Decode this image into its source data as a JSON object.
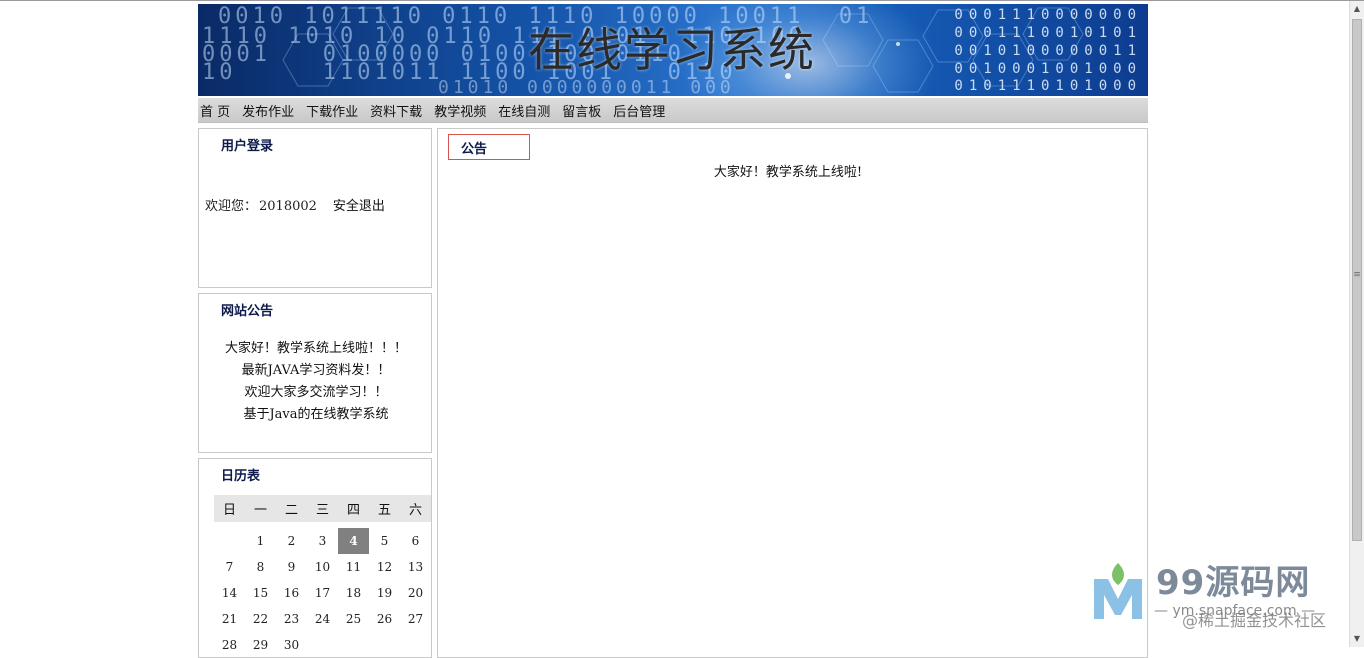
{
  "header": {
    "site_title": "在线学习系统",
    "banner_binary": {
      "b1": "0010 1011110 0110 1110 10000 10011  01",
      "b2": "1110 1010 10 0110 111 0101  110 100",
      "b3": "0001   0100000 0100 100 0110",
      "b4": "10     1101011 1100 1001   0110",
      "b5": "01010 0000000011 000",
      "r1": "0001110000000",
      "r2": "0001110010101",
      "r3": "0010100000011",
      "r4": "0010001001000",
      "r5": "0101110101000"
    }
  },
  "nav": {
    "items": [
      {
        "label": "首 页"
      },
      {
        "label": "发布作业"
      },
      {
        "label": "下载作业"
      },
      {
        "label": "资料下载"
      },
      {
        "label": "教学视频"
      },
      {
        "label": "在线自测"
      },
      {
        "label": "留言板"
      },
      {
        "label": "后台管理"
      }
    ]
  },
  "login": {
    "title": "用户登录",
    "welcome_prefix": "欢迎您：",
    "user_id": "2018002",
    "logout_label": "安全退出"
  },
  "site_notices": {
    "title": "网站公告",
    "items": [
      {
        "text": "大家好！教学系统上线啦！！！"
      },
      {
        "text": "最新JAVA学习资料发！！"
      },
      {
        "text": "欢迎大家多交流学习！！"
      },
      {
        "text": "基于Java的在线教学系统"
      }
    ]
  },
  "calendar": {
    "title": "日历表",
    "weekdays": [
      "日",
      "一",
      "二",
      "三",
      "四",
      "五",
      "六"
    ],
    "today": 4,
    "weeks": [
      [
        "",
        "1",
        "2",
        "3",
        "4",
        "5",
        "6"
      ],
      [
        "7",
        "8",
        "9",
        "10",
        "11",
        "12",
        "13"
      ],
      [
        "14",
        "15",
        "16",
        "17",
        "18",
        "19",
        "20"
      ],
      [
        "21",
        "22",
        "23",
        "24",
        "25",
        "26",
        "27"
      ],
      [
        "28",
        "29",
        "30",
        "",
        "",
        "",
        ""
      ]
    ]
  },
  "main": {
    "tab_title": "公告",
    "announcement": "大家好！教学系统上线啦!"
  },
  "watermark": {
    "brand": "99源码网",
    "url": "— ym.snapface.com —",
    "overlay": "@稀土掘金技术社区"
  },
  "colors": {
    "banner_blue": "#1453a8",
    "nav_gray": "#d2d2d2",
    "tab_border_red": "#d9534f",
    "title_navy": "#0d1a4a",
    "today_bg": "#808080"
  }
}
